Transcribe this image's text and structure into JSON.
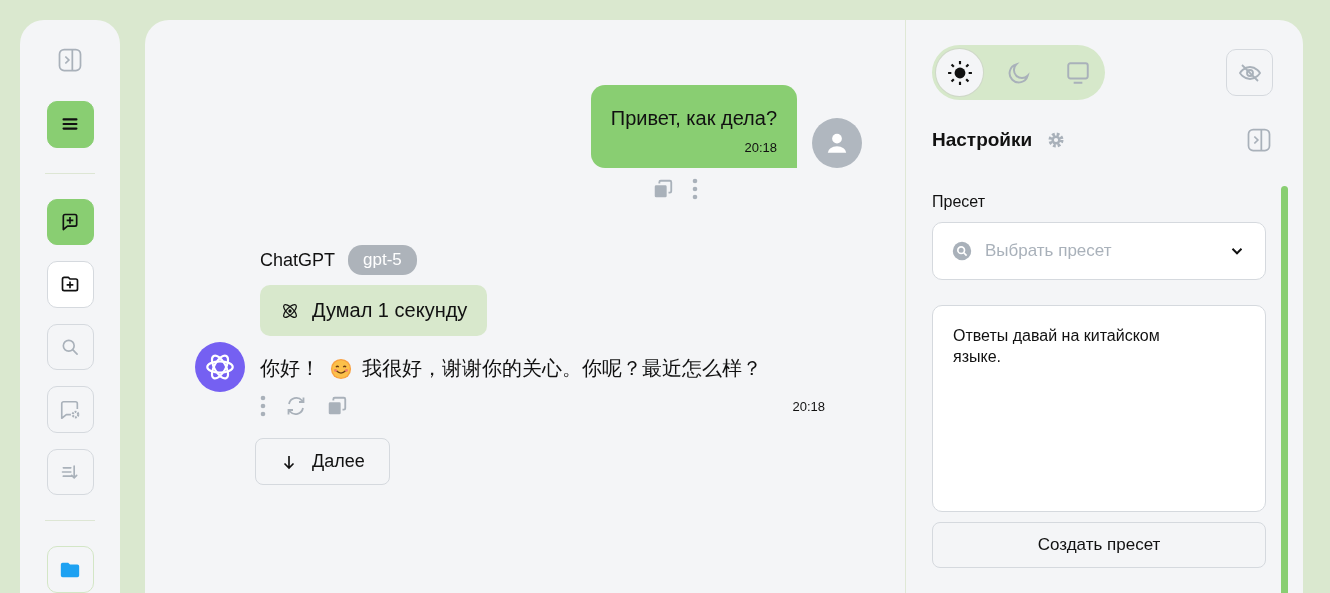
{
  "sidebar": {
    "items": [
      {
        "kind": "panel-toggle"
      },
      {
        "kind": "menu",
        "highlighted": true,
        "disabled": false
      },
      {
        "kind": "divider"
      },
      {
        "kind": "new-chat",
        "highlighted": true,
        "disabled": false
      },
      {
        "kind": "new-folder",
        "highlighted": false,
        "disabled": false
      },
      {
        "kind": "search",
        "highlighted": false,
        "disabled": true
      },
      {
        "kind": "chat-settings",
        "highlighted": false,
        "disabled": true
      },
      {
        "kind": "sort",
        "highlighted": false,
        "disabled": true
      },
      {
        "kind": "divider"
      },
      {
        "kind": "folder"
      }
    ]
  },
  "chat": {
    "messages": [
      {
        "kind": "user",
        "text": "Привет, как дела?",
        "time": "20:18"
      },
      {
        "kind": "assistant",
        "author": "ChatGPT",
        "model": "gpt-5",
        "thinking": "Думал 1 секунду",
        "text_before": "你好！",
        "text_after": "我很好，谢谢你的关心。你呢？最近怎么样？",
        "time": "20:18"
      }
    ],
    "more_button": "Далее"
  },
  "settings": {
    "theme_options": [
      {
        "kind": "light",
        "selected": true
      },
      {
        "kind": "dark",
        "selected": false
      },
      {
        "kind": "system",
        "selected": false
      }
    ],
    "title": "Настройки",
    "preset_label": "Пресет",
    "preset_select": {
      "placeholder": "Выбрать пресет"
    },
    "instructions": {
      "value": "Ответы давай на китайском языке."
    },
    "create_button": "Создать пресет"
  }
}
